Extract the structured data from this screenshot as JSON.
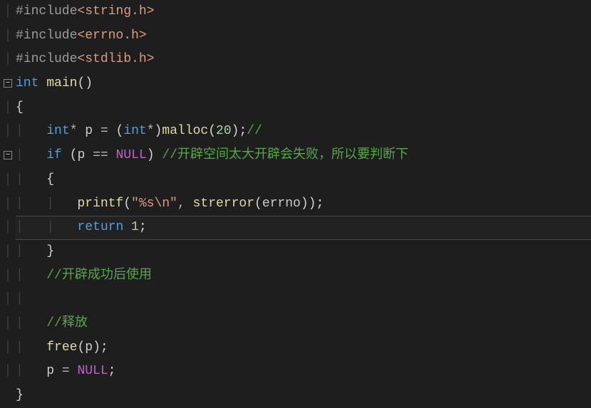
{
  "lines": {
    "inc1_pp": "#include",
    "inc1_hdr": "<string.h>",
    "inc2_pp": "#include",
    "inc2_hdr": "<errno.h>",
    "inc3_pp": "#include",
    "inc3_hdr": "<stdlib.h>",
    "kw_int": "int",
    "fn_main": "main",
    "parens_empty": "()",
    "brace_open": "{",
    "brace_close": "}",
    "kw_int2": "int",
    "star": "* ",
    "var_p": "p",
    "eq": " = ",
    "lpar": "(",
    "rpar": ")",
    "cast_int": "int",
    "cast_star": "*",
    "fn_malloc": "malloc",
    "num_20": "20",
    "semi": ";",
    "cmt_empty": "//",
    "kw_if": "if",
    "space": " ",
    "eqeq": " == ",
    "macro_null": "NULL",
    "cmt_if": "//开辟空间太大开辟会失败，所以要判断下",
    "fn_printf": "printf",
    "str_fmt": "\"%s\\n\"",
    "comma": ", ",
    "fn_strerror": "strerror",
    "id_errno": "errno",
    "kw_return": "return",
    "num_1": "1",
    "cmt_use": "//开辟成功后使用",
    "cmt_free": "//释放",
    "fn_free": "free",
    "id_p2": "p",
    "eq2": " = ",
    "macro_null2": "NULL"
  },
  "highlight_line_index": 9
}
